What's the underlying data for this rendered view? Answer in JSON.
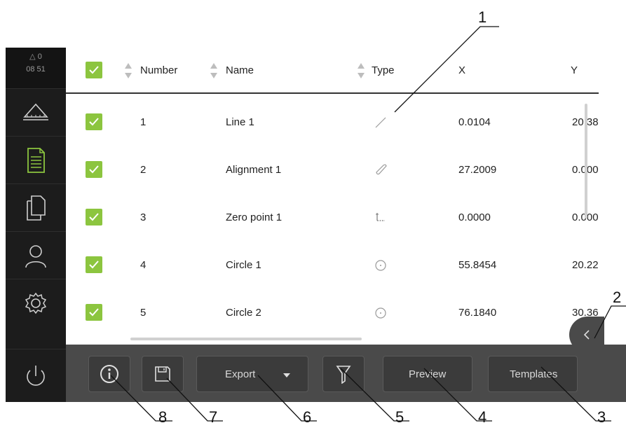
{
  "status": {
    "warnings": "0",
    "time": "08 51"
  },
  "sidebar": {
    "items": [
      {
        "icon": "measure-icon"
      },
      {
        "icon": "measurement-report-icon",
        "active": true
      },
      {
        "icon": "file-management-icon"
      },
      {
        "icon": "user-icon"
      },
      {
        "icon": "settings-icon"
      },
      {
        "icon": "power-icon"
      }
    ]
  },
  "table": {
    "columns": [
      "Number",
      "Name",
      "Type",
      "X",
      "Y"
    ],
    "rows": [
      {
        "number": "1",
        "name": "Line 1",
        "type_icon": "line-icon",
        "x": "0.0104",
        "y": "20.38"
      },
      {
        "number": "2",
        "name": "Alignment 1",
        "type_icon": "alignment-icon",
        "x": "27.2009",
        "y": "0.000"
      },
      {
        "number": "3",
        "name": "Zero point 1",
        "type_icon": "zero-point-icon",
        "x": "0.0000",
        "y": "0.000"
      },
      {
        "number": "4",
        "name": "Circle 1",
        "type_icon": "circle-icon",
        "x": "55.8454",
        "y": "20.22"
      },
      {
        "number": "5",
        "name": "Circle 2",
        "type_icon": "circle-icon",
        "x": "76.1840",
        "y": "30.36"
      }
    ]
  },
  "toolbar": {
    "export_label": "Export",
    "preview_label": "Preview",
    "templates_label": "Templates"
  },
  "callouts": [
    "1",
    "2",
    "3",
    "4",
    "5",
    "6",
    "7",
    "8"
  ],
  "colors": {
    "accent": "#8cc53f",
    "sidebar": "#1c1c1c",
    "toolbar": "#4a4a4a"
  }
}
